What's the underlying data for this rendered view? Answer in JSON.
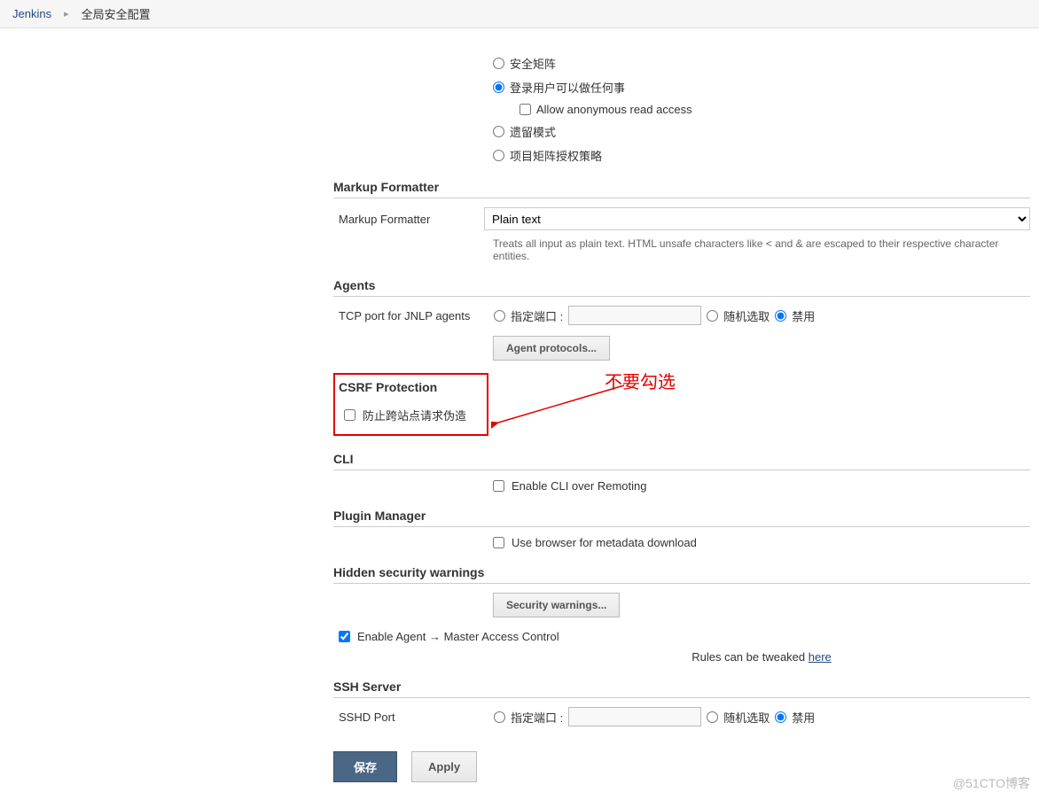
{
  "breadcrumb": {
    "root": "Jenkins",
    "page": "全局安全配置"
  },
  "authz": {
    "opt_matrix": "安全矩阵",
    "opt_logged_in": "登录用户可以做任何事",
    "allow_anon": "Allow anonymous read access",
    "opt_legacy": "遗留模式",
    "opt_project_matrix": "项目矩阵授权策略"
  },
  "markup": {
    "heading": "Markup Formatter",
    "label": "Markup Formatter",
    "selected": "Plain text",
    "help": "Treats all input as plain text. HTML unsafe characters like < and & are escaped to their respective character entities."
  },
  "agents": {
    "heading": "Agents",
    "label": "TCP port for JNLP agents",
    "opt_fixed": "指定端口 :",
    "opt_random": "随机选取",
    "opt_disable": "禁用",
    "protocols_btn": "Agent protocols..."
  },
  "csrf": {
    "heading": "CSRF Protection",
    "checkbox": "防止跨站点请求伪造",
    "annotation": "不要勾选"
  },
  "cli": {
    "heading": "CLI",
    "checkbox": "Enable CLI over Remoting"
  },
  "plugin": {
    "heading": "Plugin Manager",
    "checkbox": "Use browser for metadata download"
  },
  "hidden": {
    "heading": "Hidden security warnings",
    "btn": "Security warnings...",
    "agent_master": "Enable Agent → Master Access Control",
    "tweak_prefix": "Rules can be tweaked ",
    "tweak_link": "here"
  },
  "ssh": {
    "heading": "SSH Server",
    "label": "SSHD Port",
    "opt_fixed": "指定端口 :",
    "opt_random": "随机选取",
    "opt_disable": "禁用"
  },
  "buttons": {
    "save": "保存",
    "apply": "Apply"
  },
  "watermark": "@51CTO博客"
}
